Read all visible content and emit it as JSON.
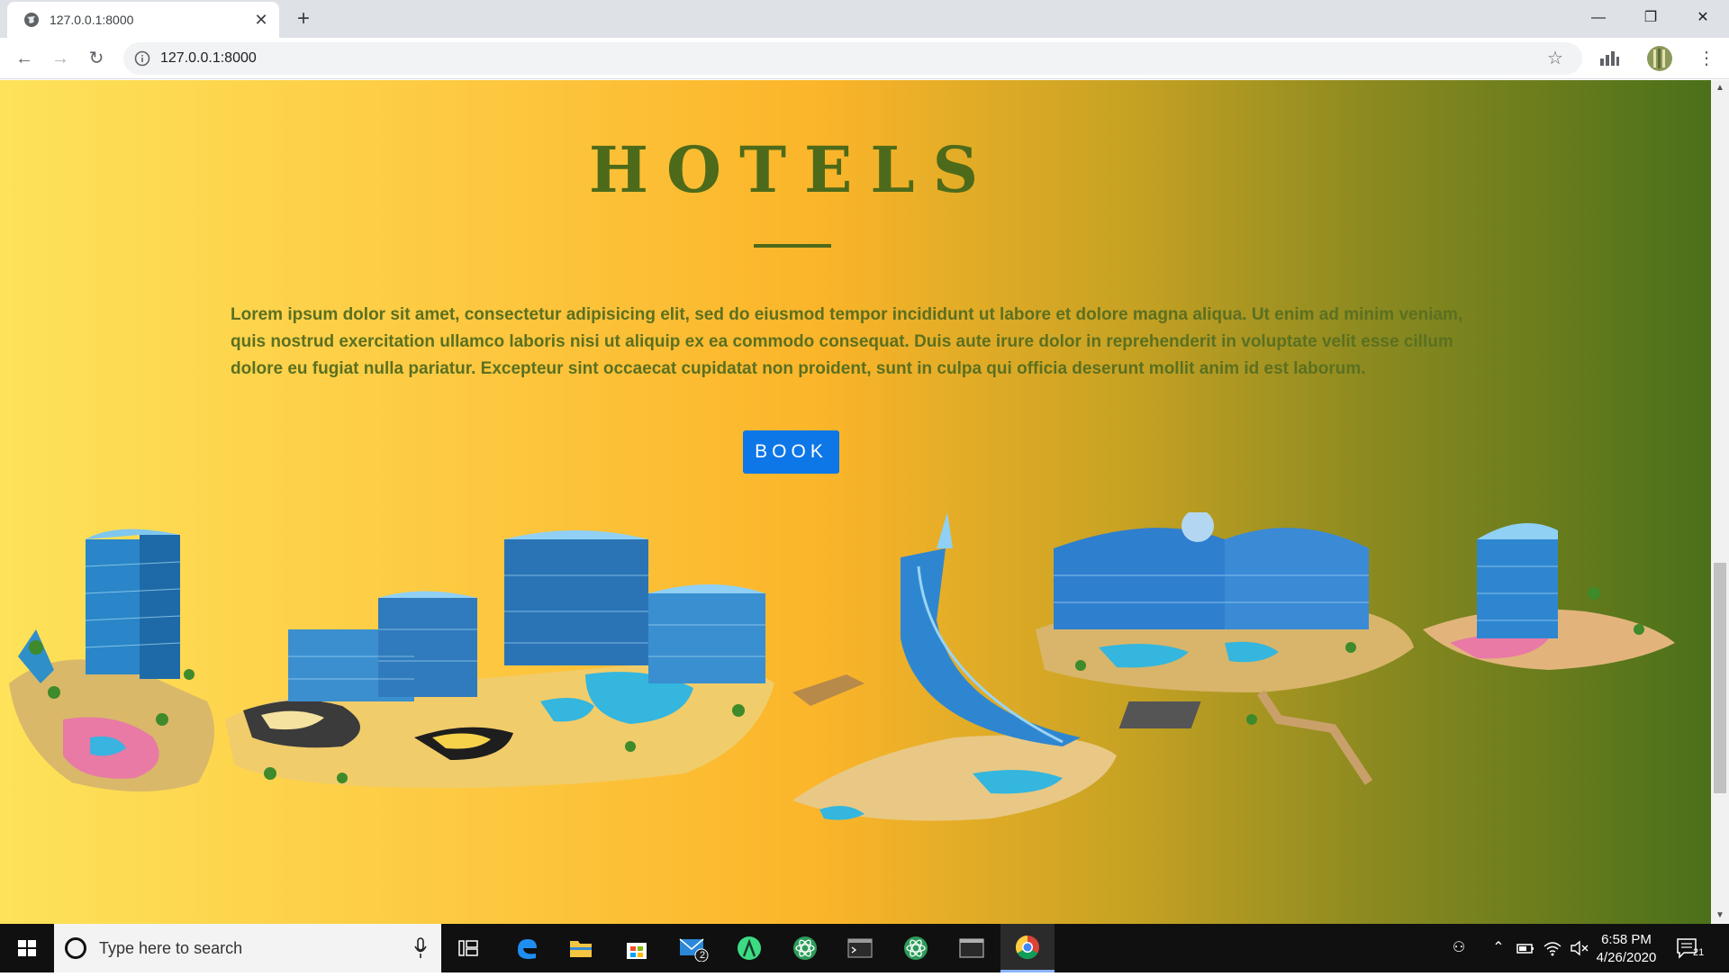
{
  "browser": {
    "tab_title": "127.0.0.1:8000",
    "tab_close": "✕",
    "new_tab": "+",
    "url": "127.0.0.1:8000",
    "window_controls": {
      "minimize": "—",
      "restore": "❐",
      "close": "✕"
    },
    "nav": {
      "back": "←",
      "forward": "→",
      "reload": "↻"
    },
    "bookmark_star": "☆",
    "menu": "⋮"
  },
  "page": {
    "title": "HOTELS",
    "body_text": "Lorem ipsum dolor sit amet, consectetur adipisicing elit, sed do eiusmod tempor incididunt ut labore et dolore magna aliqua. Ut enim ad minim veniam, quis nostrud exercitation ullamco laboris nisi ut aliquip ex ea commodo consequat. Duis aute irure dolor in reprehenderit in voluptate velit esse cillum dolore eu fugiat nulla pariatur. Excepteur sint occaecat cupidatat non proident, sunt in culpa qui officia deserunt mollit anim id est laborum.",
    "book_button": "BOOK",
    "colors": {
      "gradient_start": "#fde25a",
      "gradient_mid": "#fbb52a",
      "gradient_end": "#4a7019",
      "title": "#4d6a1a",
      "button": "#0d77e8"
    }
  },
  "taskbar": {
    "search_placeholder": "Type here to search",
    "mail_badge": "2",
    "clock_time": "6:58 PM",
    "clock_date": "4/26/2020",
    "notification_count": "21",
    "icons": [
      "windows-start-icon",
      "task-view-icon",
      "edge-icon",
      "file-explorer-icon",
      "store-icon",
      "mail-icon",
      "android-studio-icon",
      "atom-icon",
      "terminal-icon",
      "atom-icon-2",
      "window-icon",
      "chrome-icon"
    ]
  }
}
